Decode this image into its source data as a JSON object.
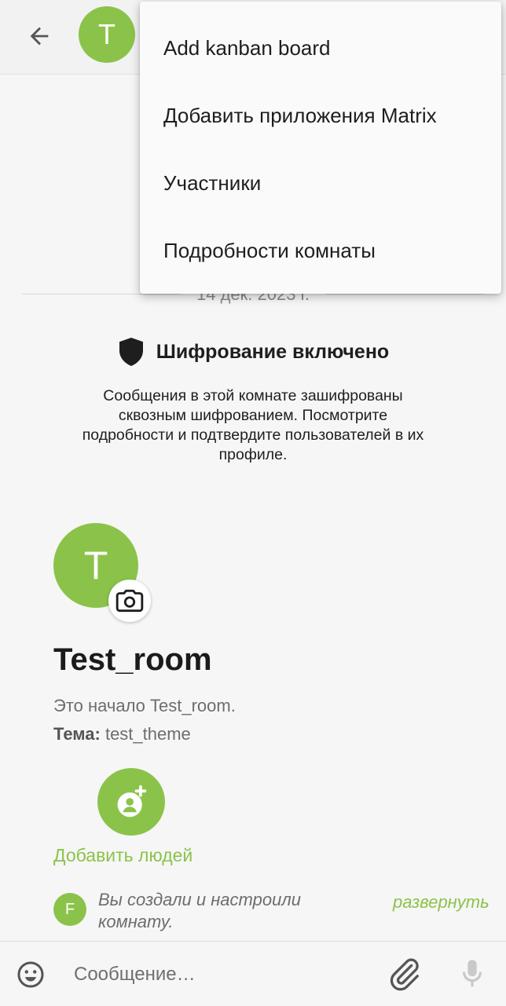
{
  "app_bar": {
    "avatar_letter": "T"
  },
  "menu": {
    "items": [
      {
        "label": "Add kanban board"
      },
      {
        "label": "Добавить приложения Matrix"
      },
      {
        "label": "Участники"
      },
      {
        "label": "Подробности комнаты"
      }
    ]
  },
  "timeline": {
    "date_divider": "14 дек. 2023 г.",
    "encryption": {
      "title": "Шифрование включено",
      "description": "Сообщения в этой комнате зашифрованы сквозным шифрованием. Посмотрите подробности и подтвердите пользователей в их профиле."
    },
    "room": {
      "avatar_letter": "T",
      "name": "Test_room",
      "start_text": "Это начало Test_room.",
      "topic_label": "Тема:",
      "topic_value": " test_theme",
      "add_people_label": "Добавить людей"
    },
    "event": {
      "avatar_letter": "F",
      "text": "Вы создали и настроили комнату.",
      "expand_label": "развернуть"
    }
  },
  "composer": {
    "placeholder": "Сообщение…"
  },
  "colors": {
    "accent": "#8bc34a",
    "background": "#f6f6f6"
  },
  "icons": [
    "arrow-back-icon",
    "camera-icon",
    "shield-icon",
    "add-person-icon",
    "emoji-icon",
    "paperclip-icon",
    "microphone-icon"
  ]
}
